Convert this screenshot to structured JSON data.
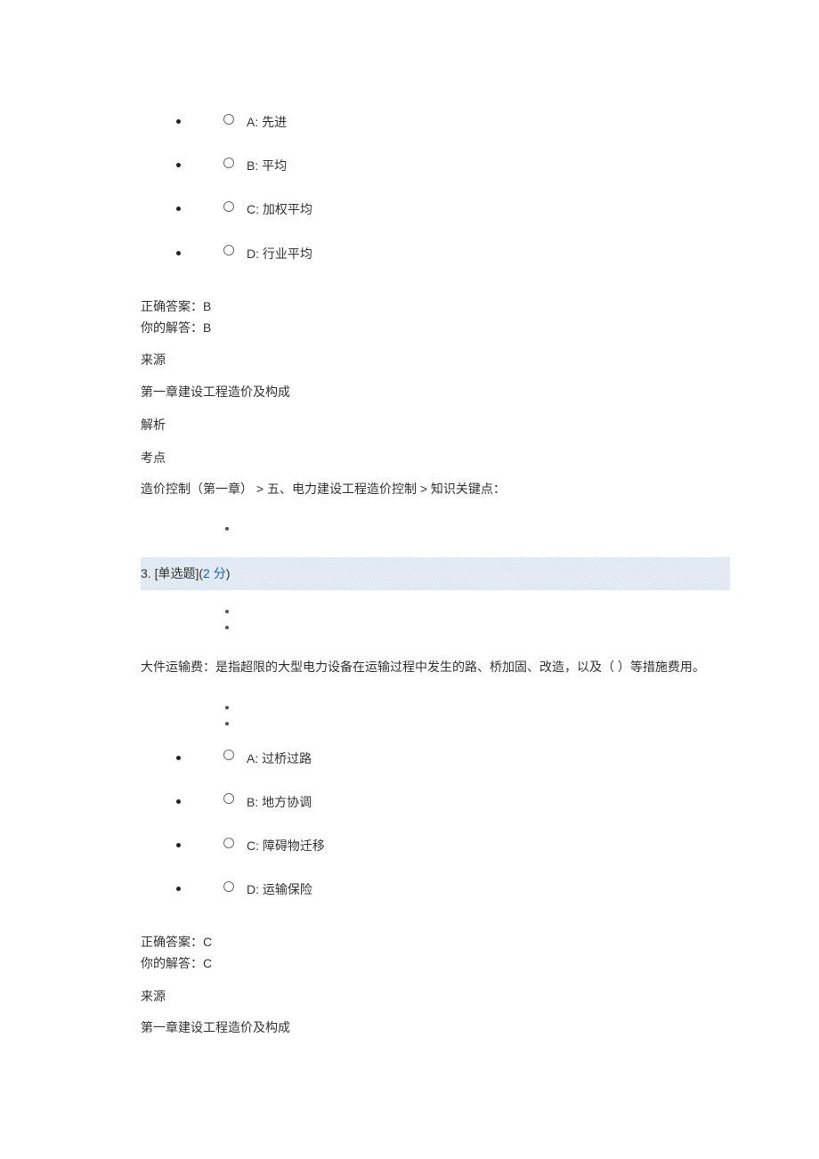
{
  "q2": {
    "options": [
      {
        "key": "A",
        "text": "先进"
      },
      {
        "key": "B",
        "text": "平均"
      },
      {
        "key": "C",
        "text": "加权平均"
      },
      {
        "key": "D",
        "text": "行业平均"
      }
    ],
    "correct_label": "正确答案：",
    "correct_value": "B",
    "your_label": "你的解答：",
    "your_value": "B",
    "source_label": " 来源",
    "source_text": "第一章建设工程造价及构成",
    "analysis_label": " 解析",
    "point_label": " 考点",
    "point_text": "造价控制（第一章）  >  五、电力建设工程造价控制  >  知识关键点："
  },
  "q3": {
    "header_num": "3. ",
    "header_type": "[单选题]",
    "header_score_open": "(",
    "header_score_value": "2 分",
    "header_score_close": ")",
    "stem": "大件运输费：是指超限的大型电力设备在运输过程中发生的路、桥加固、改造，以及（   ）等措施费用。",
    "options": [
      {
        "key": "A",
        "text": "过桥过路"
      },
      {
        "key": "B",
        "text": "地方协调"
      },
      {
        "key": "C",
        "text": "障碍物迁移"
      },
      {
        "key": "D",
        "text": "运输保险"
      }
    ],
    "correct_label": "正确答案：",
    "correct_value": "C",
    "your_label": "你的解答：",
    "your_value": "C",
    "source_label": " 来源",
    "source_text": "第一章建设工程造价及构成"
  }
}
